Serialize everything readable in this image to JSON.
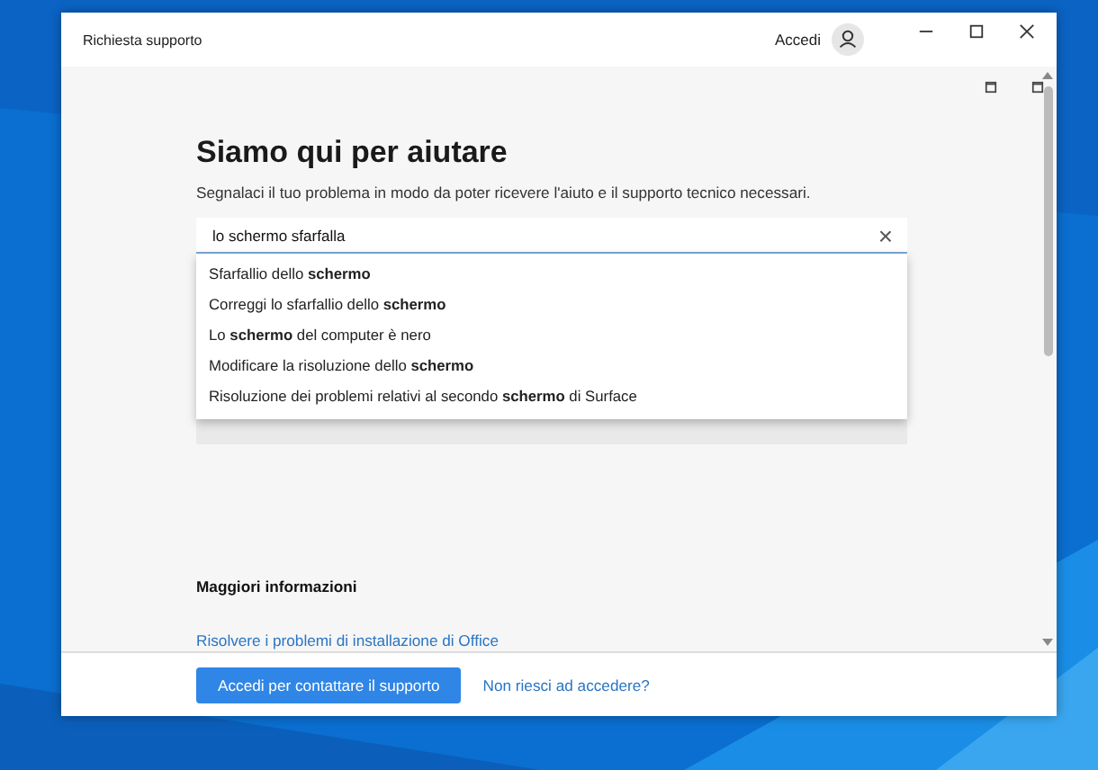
{
  "window": {
    "title": "Richiesta supporto",
    "sign_in": "Accedi"
  },
  "heading": "Siamo qui per aiutare",
  "subtitle": "Segnalaci il tuo problema in modo da poter ricevere l'aiuto e il supporto tecnico necessari.",
  "search": {
    "value": "lo schermo sfarfalla",
    "clear": "×"
  },
  "suggestions": [
    "Sfarfallio dello **schermo**",
    "Correggi lo sfarfallio dello **schermo**",
    "Lo **schermo** del computer è nero",
    "Modificare la risoluzione dello **schermo**",
    "Risoluzione dei problemi relativi al secondo **schermo** di Surface"
  ],
  "more_info": {
    "title": "Maggiori informazioni",
    "link": "Risolvere i problemi di installazione di Office"
  },
  "footer": {
    "button": "Accedi per contattare il supporto",
    "link": "Non riesci ad accedere?"
  }
}
